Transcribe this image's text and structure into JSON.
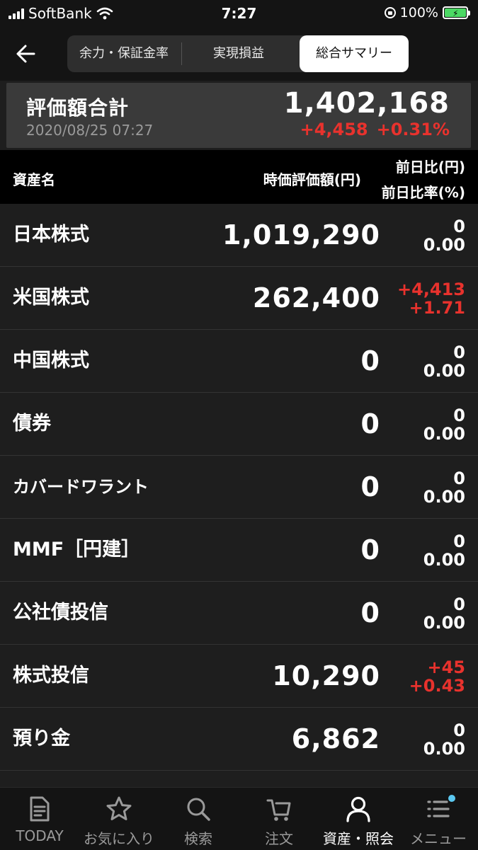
{
  "status_bar": {
    "carrier": "SoftBank",
    "time": "7:27",
    "battery": "100%"
  },
  "header": {
    "tabs": [
      {
        "label": "余力・保証金率"
      },
      {
        "label": "実現損益"
      },
      {
        "label": "総合サマリー",
        "active": true
      }
    ]
  },
  "summary": {
    "title": "評価額合計",
    "date": "2020/08/25 07:27",
    "total": "1,402,168",
    "change_amount": "+4,458",
    "change_percent": "+0.31%"
  },
  "columns": {
    "name": "資産名",
    "value": "時価評価額(円)",
    "diff_amount": "前日比(円)",
    "diff_rate": "前日比率(%)"
  },
  "assets": [
    {
      "name": "日本株式",
      "value": "1,019,290",
      "diff": "0",
      "rate": "0.00"
    },
    {
      "name": "米国株式",
      "value": "262,400",
      "diff": "+4,413",
      "rate": "+1.71"
    },
    {
      "name": "中国株式",
      "value": "0",
      "diff": "0",
      "rate": "0.00"
    },
    {
      "name": "債券",
      "value": "0",
      "diff": "0",
      "rate": "0.00"
    },
    {
      "name": "カバードワラント",
      "value": "0",
      "diff": "0",
      "rate": "0.00"
    },
    {
      "name": "MMF［円建］",
      "value": "0",
      "diff": "0",
      "rate": "0.00"
    },
    {
      "name": "公社債投信",
      "value": "0",
      "diff": "0",
      "rate": "0.00"
    },
    {
      "name": "株式投信",
      "value": "10,290",
      "diff": "+45",
      "rate": "+0.43"
    },
    {
      "name": "預り金",
      "value": "6,862",
      "diff": "0",
      "rate": "0.00"
    }
  ],
  "tabbar": {
    "items": [
      {
        "label": "TODAY",
        "icon": "document-icon"
      },
      {
        "label": "お気に入り",
        "icon": "star-icon"
      },
      {
        "label": "検索",
        "icon": "search-icon"
      },
      {
        "label": "注文",
        "icon": "cart-icon"
      },
      {
        "label": "資産・照会",
        "icon": "person-icon",
        "active": true
      },
      {
        "label": "メニュー",
        "icon": "menu-icon"
      }
    ]
  },
  "colors": {
    "up": "#e8322d",
    "background": "#1e1e1e",
    "badge": "#5bc8f0"
  }
}
